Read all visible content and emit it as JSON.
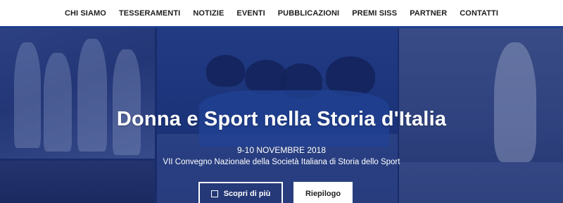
{
  "nav": {
    "items": [
      "CHI SIAMO",
      "TESSERAMENTI",
      "NOTIZIE",
      "EVENTI",
      "PUBBLICAZIONI",
      "PREMI SISS",
      "PARTNER",
      "CONTATTI"
    ]
  },
  "hero": {
    "title": "Donna e Sport nella Storia d'Italia",
    "date": "9-10 NOVEMBRE 2018",
    "subtitle": "VII Convegno Nazionale della Società Italiana di Storia dello Sport",
    "buttons": {
      "more_label": "Scopri di più",
      "more_icon": "checkbox-icon",
      "summary_label": "Riepilogo"
    }
  },
  "colors": {
    "nav_border": "#1f3f8f",
    "hero_overlay": "#14286e"
  }
}
